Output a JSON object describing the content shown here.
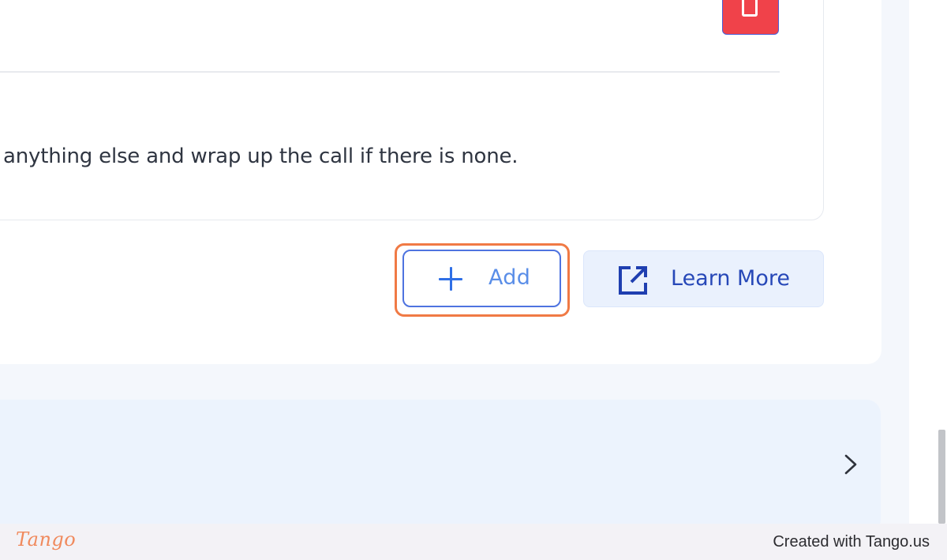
{
  "colors": {
    "accent": "#4e73e0",
    "focus_ring": "#f07a45",
    "delete_button": "#f0424a",
    "learn_more_bg": "#eaf1fd",
    "collapsed_section_bg": "#ecf3fd"
  },
  "rule": {
    "text": "anything else and wrap up the call if there is none."
  },
  "actions": {
    "add_label": "Add",
    "add_icon": "plus-icon",
    "learn_more_label": "Learn More",
    "learn_more_icon": "external-link-icon",
    "delete_icon": "trash-icon"
  },
  "collapsed_section": {
    "icon": "chevron-right-icon"
  },
  "footer": {
    "logo": "Tango",
    "credit": "Created with Tango.us"
  }
}
